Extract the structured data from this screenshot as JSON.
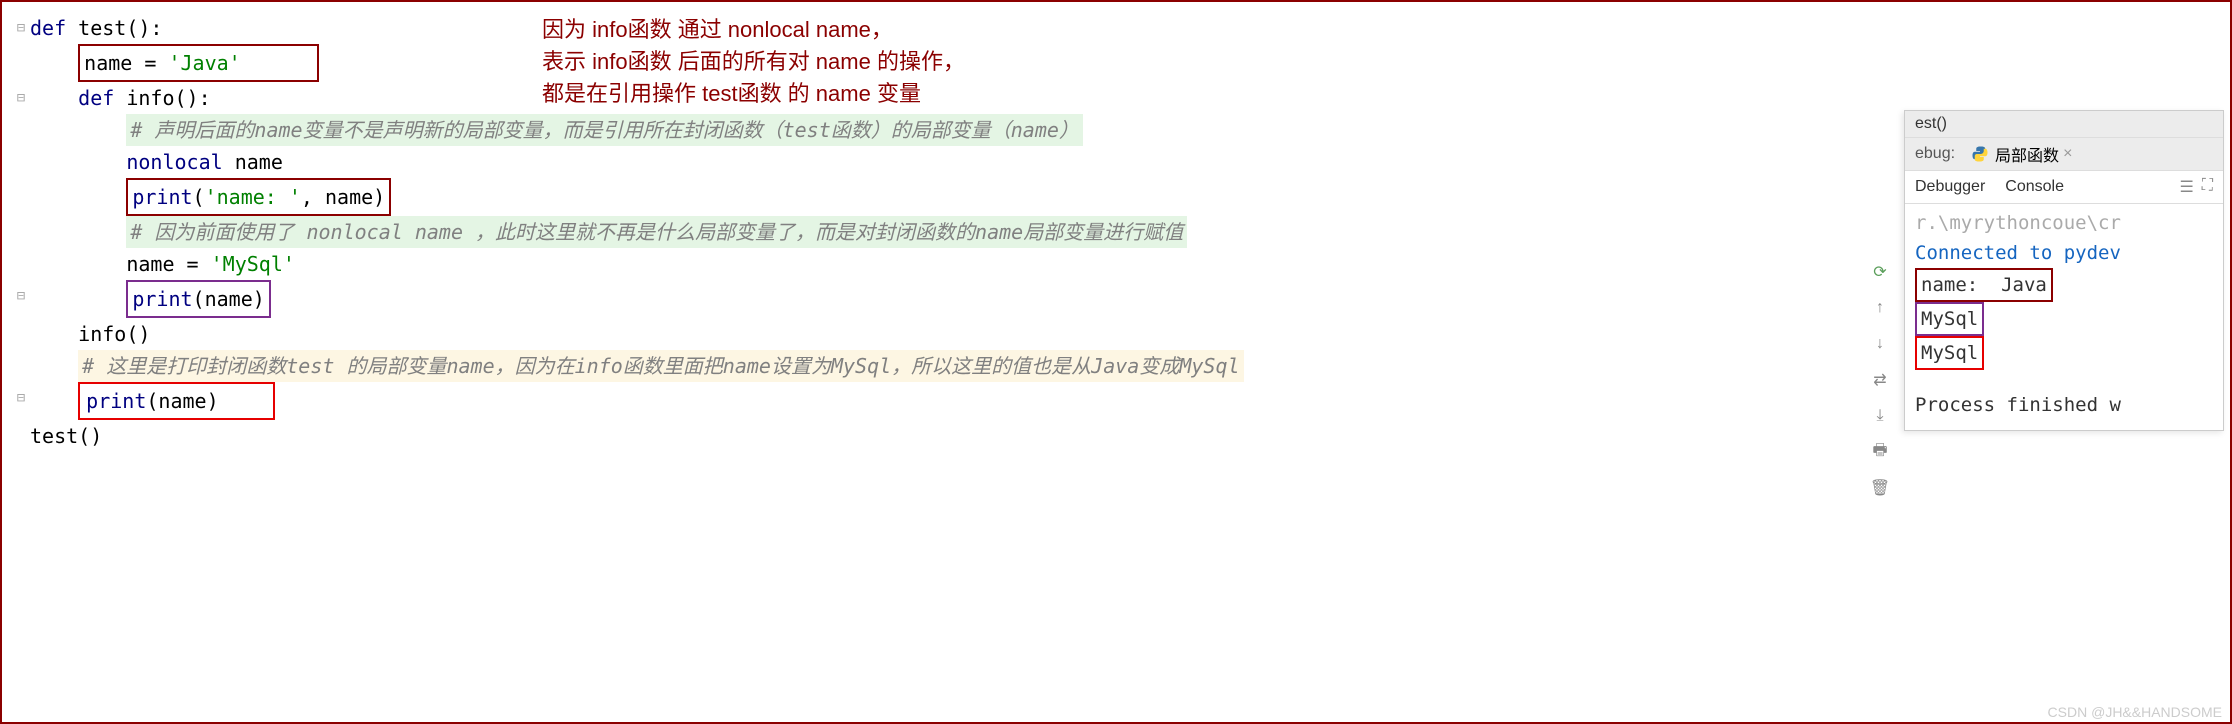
{
  "code": {
    "line1_def": "def",
    "line1_fn": "test",
    "line1_rest": "():",
    "line2_pre": "name = ",
    "line2_str": "'Java'",
    "line3_def": "def",
    "line3_fn": "info",
    "line3_rest": "():",
    "line4_comment": "# 声明后面的name变量不是声明新的局部变量，而是引用所在封闭函数（test函数）的局部变量（name）",
    "line5_kw": "nonlocal",
    "line5_var": "name",
    "line6_print": "print",
    "line6_arg1": "'name: '",
    "line6_arg2": ", name)",
    "line7_comment": "# 因为前面使用了 nonlocal name ，此时这里就不再是什么局部变量了，而是对封闭函数的name局部变量进行赋值",
    "line8_pre": "name = ",
    "line8_str": "'MySql'",
    "line9_print": "print",
    "line9_arg": "(name)",
    "line10": "info()",
    "line11_comment": "# 这里是打印封闭函数test 的局部变量name，因为在info函数里面把name设置为MySql，所以这里的值也是从Java变成MySql",
    "line12_print": "print",
    "line12_arg": "(name)",
    "line13": "test()"
  },
  "annotation": {
    "l1": "因为 info函数 通过 nonlocal name，",
    "l2": "表示 info函数 后面的所有对 name 的操作，",
    "l3": "都是在引用操作 test函数 的 name 变量"
  },
  "debug": {
    "breadcrumb": "est()",
    "ebug_label": "ebug:",
    "tab_name": "局部函数",
    "subtab1": "Debugger",
    "subtab2": "Console",
    "out0": "r.\\myrythoncoue\\cr",
    "out1": "Connected to pydev",
    "out2": "name:  Java",
    "out3": "MySql",
    "out4": "MySql",
    "out5": "Process finished w"
  },
  "watermark": "CSDN @JH&&HANDSOME"
}
